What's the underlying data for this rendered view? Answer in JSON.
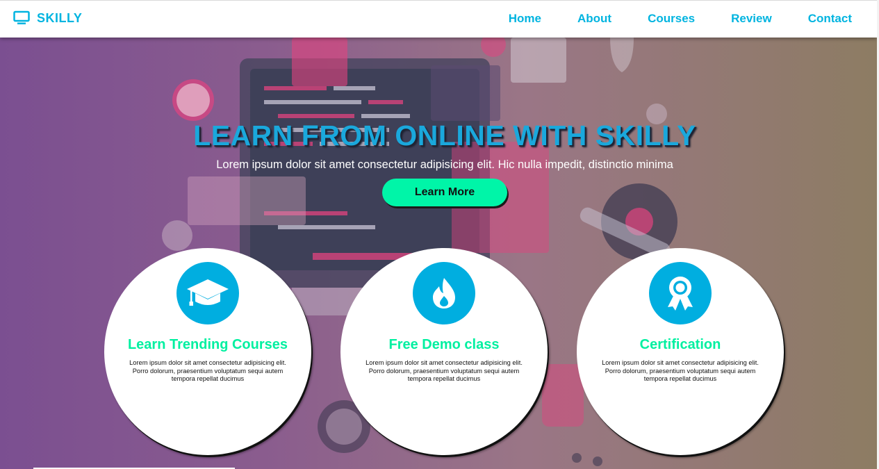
{
  "brand": {
    "name": "SKILLY",
    "icon": "monitor-icon"
  },
  "nav": {
    "links": [
      "Home",
      "About",
      "Courses",
      "Review",
      "Contact"
    ]
  },
  "hero": {
    "title": "LEARN FROM ONLINE WITH SKILLY",
    "subtitle": "Lorem ipsum dolor sit amet consectetur adipisicing elit. Hic nulla impedit, distinctio minima",
    "cta_label": "Learn More"
  },
  "features": [
    {
      "icon": "graduation-cap-icon",
      "title": "Learn Trending Courses",
      "text": "Lorem ipsum dolor sit amet consectetur adipisicing elit. Porro dolorum, praesentium voluptatum sequi autem tempora repellat ducimus"
    },
    {
      "icon": "flame-icon",
      "title": "Free Demo class",
      "text": "Lorem ipsum dolor sit amet consectetur adipisicing elit. Porro dolorum, praesentium voluptatum sequi autem tempora repellat ducimus"
    },
    {
      "icon": "award-ribbon-icon",
      "title": "Certification",
      "text": "Lorem ipsum dolor sit amet consectetur adipisicing elit. Porro dolorum, praesentium voluptatum sequi autem tempora repellat ducimus"
    }
  ],
  "colors": {
    "accent": "#00b4e0",
    "cta": "#00f5a8",
    "feature_title": "#00f0a0",
    "badge": "#00aee0"
  }
}
